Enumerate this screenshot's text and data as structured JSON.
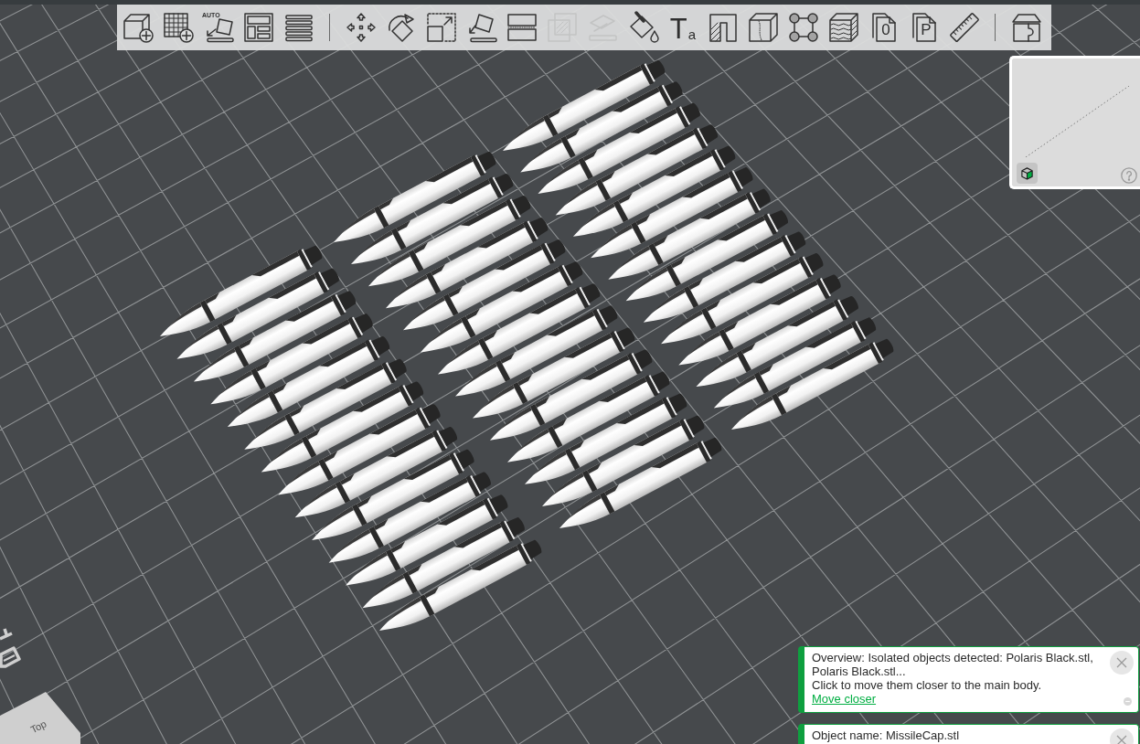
{
  "toolbar": {
    "groups": [
      {
        "buttons": [
          {
            "disabled": false
          },
          {
            "disabled": false
          },
          {
            "disabled": false,
            "glyph": "AUTO"
          },
          {
            "disabled": false
          },
          {
            "disabled": false
          }
        ]
      },
      {
        "buttons": [
          {
            "disabled": false
          },
          {
            "disabled": false
          },
          {
            "disabled": false
          },
          {
            "disabled": false
          },
          {
            "disabled": false
          },
          {
            "disabled": true
          },
          {
            "disabled": true
          },
          {
            "disabled": false
          },
          {
            "disabled": false,
            "glyph": "T",
            "subglyph": "a"
          },
          {
            "disabled": false
          },
          {
            "disabled": false
          },
          {
            "disabled": false
          },
          {
            "disabled": false
          },
          {
            "disabled": false,
            "glyph": "0"
          },
          {
            "disabled": false,
            "glyph": "P"
          },
          {
            "disabled": false
          }
        ]
      },
      {
        "buttons": [
          {
            "disabled": false
          }
        ]
      }
    ]
  },
  "view_cube": {
    "label": "Top"
  },
  "notifications": [
    {
      "message": "Overview: Isolated objects detected: Polaris Black.stl, Polaris Black.stl...",
      "hint": "Click to move them closer to the main body.",
      "link": "Move closer"
    },
    {
      "message": "Object name: MissileCap.stl"
    }
  ]
}
